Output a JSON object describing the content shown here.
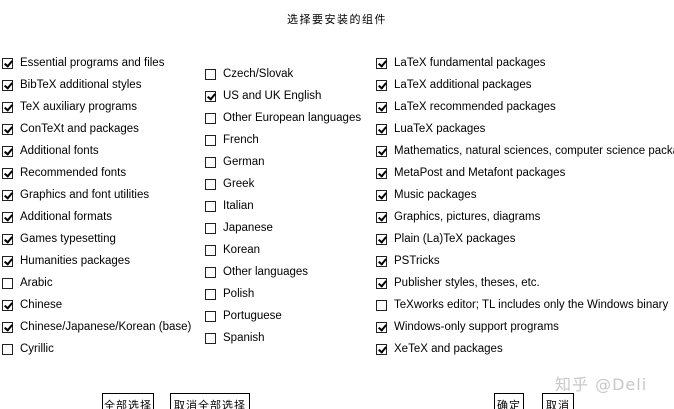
{
  "dialog": {
    "title": "选择要安装的组件"
  },
  "columns": [
    {
      "items": [
        {
          "label": "Essential programs and files",
          "checked": true
        },
        {
          "label": "BibTeX additional styles",
          "checked": true
        },
        {
          "label": "TeX auxiliary programs",
          "checked": true
        },
        {
          "label": "ConTeXt and packages",
          "checked": true
        },
        {
          "label": "Additional fonts",
          "checked": true
        },
        {
          "label": "Recommended fonts",
          "checked": true
        },
        {
          "label": "Graphics and font utilities",
          "checked": true
        },
        {
          "label": "Additional formats",
          "checked": true
        },
        {
          "label": "Games typesetting",
          "checked": true
        },
        {
          "label": "Humanities packages",
          "checked": true
        },
        {
          "label": "Arabic",
          "checked": false
        },
        {
          "label": "Chinese",
          "checked": true
        },
        {
          "label": "Chinese/Japanese/Korean (base)",
          "checked": true
        },
        {
          "label": "Cyrillic",
          "checked": false
        }
      ]
    },
    {
      "items": [
        {
          "label": "Czech/Slovak",
          "checked": false
        },
        {
          "label": "US and UK English",
          "checked": true
        },
        {
          "label": "Other European languages",
          "checked": false
        },
        {
          "label": "French",
          "checked": false
        },
        {
          "label": "German",
          "checked": false
        },
        {
          "label": "Greek",
          "checked": false
        },
        {
          "label": "Italian",
          "checked": false
        },
        {
          "label": "Japanese",
          "checked": false
        },
        {
          "label": "Korean",
          "checked": false
        },
        {
          "label": "Other languages",
          "checked": false
        },
        {
          "label": "Polish",
          "checked": false
        },
        {
          "label": "Portuguese",
          "checked": false
        },
        {
          "label": "Spanish",
          "checked": false
        }
      ]
    },
    {
      "items": [
        {
          "label": "LaTeX fundamental packages",
          "checked": true
        },
        {
          "label": "LaTeX additional packages",
          "checked": true
        },
        {
          "label": "LaTeX recommended packages",
          "checked": true
        },
        {
          "label": "LuaTeX packages",
          "checked": true
        },
        {
          "label": "Mathematics, natural sciences, computer science packages",
          "checked": true
        },
        {
          "label": "MetaPost and Metafont packages",
          "checked": true
        },
        {
          "label": "Music packages",
          "checked": true
        },
        {
          "label": "Graphics, pictures, diagrams",
          "checked": true
        },
        {
          "label": "Plain (La)TeX packages",
          "checked": true
        },
        {
          "label": "PSTricks",
          "checked": true
        },
        {
          "label": "Publisher styles, theses, etc.",
          "checked": true
        },
        {
          "label": "TeXworks editor; TL includes only the Windows binary",
          "checked": false
        },
        {
          "label": "Windows-only support programs",
          "checked": true
        },
        {
          "label": "XeTeX and packages",
          "checked": true
        }
      ]
    }
  ],
  "buttons": {
    "select_all": "全部选择",
    "deselect_all": "取消全部选择",
    "ok": "确定",
    "cancel": "取消"
  },
  "watermark": "知乎 @Deli"
}
